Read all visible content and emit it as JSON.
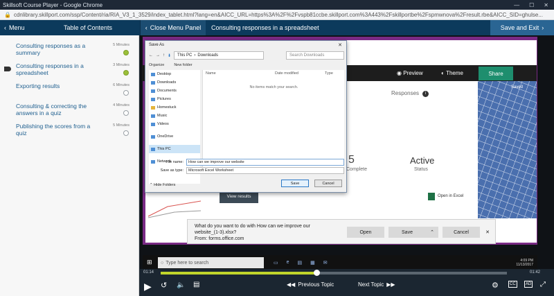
{
  "browser": {
    "title": "Skillsoft Course Player - Google Chrome",
    "url": "cdnlibrary.skillport.com/ssp/Content/ria/RIA_V3_1_3529/index_tablet.html?lang=en&AICC_URL=https%3A%2F%2Fvspb81ccbe.skillport.com%3A443%2Fskillportbe%2Fspmwnova%2Fresult.rbe&AICC_SID=ghulse..."
  },
  "header": {
    "menu": "Menu",
    "toc": "Table of Contents",
    "close_panel": "Close Menu Panel",
    "topic_title": "Consulting responses in a spreadsheet",
    "save_exit": "Save and Exit"
  },
  "sidebar": {
    "items": [
      {
        "label": "Consulting responses as a summary",
        "minutes": "5 Minutes",
        "status": "complete"
      },
      {
        "label": "Consulting responses in a spreadsheet",
        "minutes": "3 Minutes",
        "status": "complete",
        "current": true
      },
      {
        "label": "Exporting results",
        "minutes": "6 Minutes",
        "status": "incomplete"
      },
      {
        "label": "Consulting & correcting the answers in a quiz",
        "minutes": "4 Minutes",
        "status": "incomplete"
      },
      {
        "label": "Publishing the scores from a quiz",
        "minutes": "5 Minutes",
        "status": "incomplete"
      }
    ]
  },
  "forms": {
    "preview": "Preview",
    "theme": "Theme",
    "share": "Share",
    "responses": "Responses",
    "big_number": "5",
    "complete": "Complete",
    "status_value": "Active",
    "status_label": "Status",
    "open_excel": "Open in Excel",
    "view_results": "View results",
    "saved": "Saved"
  },
  "dialog": {
    "title": "Save As",
    "path_pc": "This PC",
    "path_folder": "Downloads",
    "search_placeholder": "Search Downloads",
    "organize": "Organize",
    "new_folder": "New folder",
    "tree": [
      "Desktop",
      "Downloads",
      "Documents",
      "Pictures",
      "Homestuck",
      "Music",
      "Videos",
      "OneDrive",
      "This PC",
      "Network"
    ],
    "col_name": "Name",
    "col_date": "Date modified",
    "col_type": "Type",
    "empty": "No items match your search.",
    "file_name_label": "File name:",
    "file_name_value": "How can we improve our website",
    "save_type_label": "Save as type:",
    "save_type_value": "Microsoft Excel Worksheet",
    "hide_folders": "Hide Folders",
    "save": "Save",
    "cancel": "Cancel"
  },
  "download": {
    "question": "What do you want to do with How can we improve our website_(1-3).xlsx?",
    "from": "From: forms.office.com",
    "open": "Open",
    "save": "Save",
    "cancel": "Cancel"
  },
  "taskbar": {
    "search": "Type here to search",
    "time": "4:09 PM",
    "date": "11/13/2017"
  },
  "player": {
    "elapsed": "01:14",
    "total": "01:42",
    "previous": "Previous Topic",
    "next": "Next Topic",
    "progress": 0.45
  }
}
